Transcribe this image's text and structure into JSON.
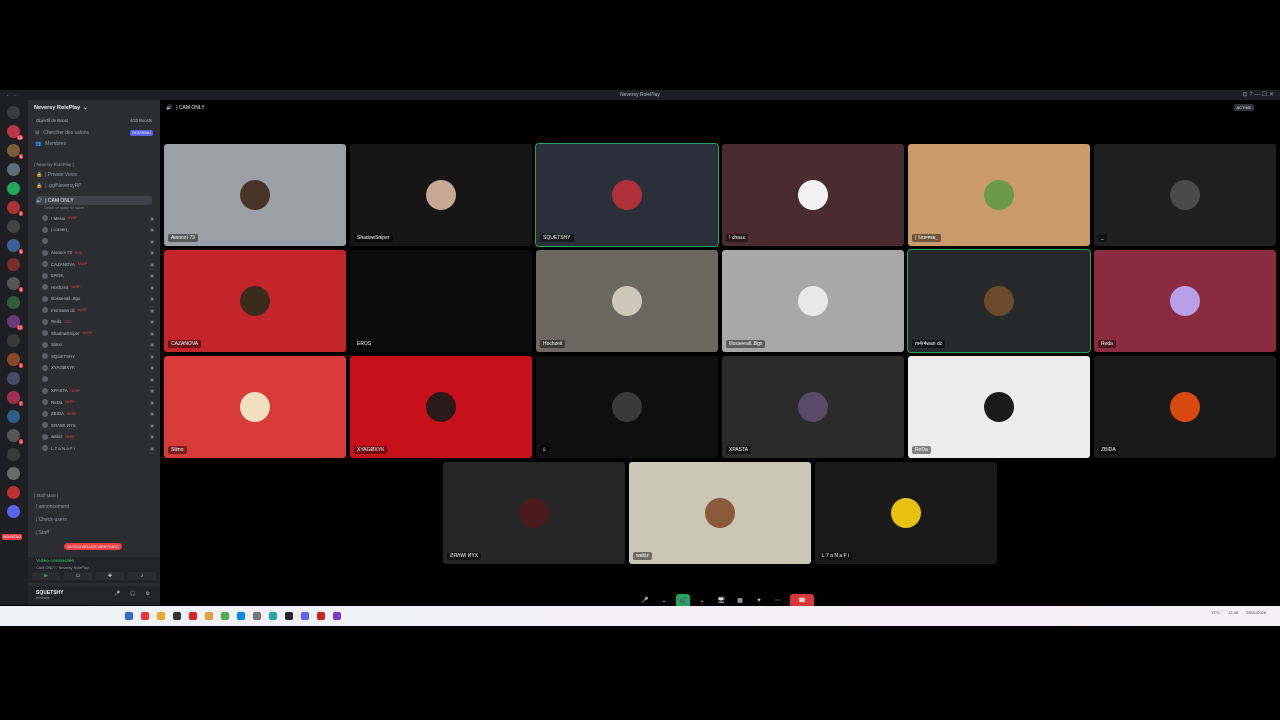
{
  "window": {
    "title": "Neversy RolePlay",
    "nav_arrows": "←  →",
    "controls": "⊡  ?  —  ☐  ✕"
  },
  "servers": {
    "items": [
      {
        "color": "#3b3c42",
        "badge": ""
      },
      {
        "color": "#b8384a",
        "badge": "16"
      },
      {
        "color": "#7a5c3a",
        "badge": "9"
      },
      {
        "color": "#5a6f7a",
        "badge": ""
      },
      {
        "color": "#23a55a",
        "badge": ""
      },
      {
        "color": "#a33",
        "badge": "2"
      },
      {
        "color": "#444",
        "badge": ""
      },
      {
        "color": "#3a5f9a",
        "badge": "5"
      },
      {
        "color": "#7a2b2b",
        "badge": ""
      },
      {
        "color": "#555",
        "badge": "3"
      },
      {
        "color": "#2f5d3a",
        "badge": ""
      },
      {
        "color": "#6a3a7a",
        "badge": "12"
      },
      {
        "color": "#3a3a3a",
        "badge": ""
      },
      {
        "color": "#8a4a2a",
        "badge": "1"
      },
      {
        "color": "#4a4a6a",
        "badge": ""
      },
      {
        "color": "#a03050",
        "badge": "7"
      },
      {
        "color": "#2b5f8a",
        "badge": ""
      },
      {
        "color": "#555",
        "badge": "4"
      },
      {
        "color": "#3a3a3a",
        "badge": ""
      },
      {
        "color": "#6a6a6a",
        "badge": ""
      },
      {
        "color": "#c03030",
        "badge": ""
      },
      {
        "color": "#5865f2",
        "badge": ""
      }
    ]
  },
  "sidebar": {
    "guild_name": "Neversy RolePlay",
    "boost_label": "Objectif de Boost",
    "boost_count": "4/33 Boosts",
    "menu": [
      {
        "label": "Chercher des salons",
        "badge": "NOUVEAU"
      },
      {
        "label": "Membres",
        "badge": ""
      }
    ],
    "category_1": "| Neversy RolePlay |",
    "channels": [
      "| Private Voice",
      "| .gg/NeversyRP",
      "| CAM ONLY"
    ],
    "channel_status": "Définir un statut de salon",
    "voice_members": [
      {
        "name": "! Messi",
        "tag": "NVRP"
      },
      {
        "name": "| coreen_",
        "tag": ""
      },
      {
        "name": "",
        "tag": ""
      },
      {
        "name": "Aiooooï 73",
        "tag": "EOS"
      },
      {
        "name": "CAZANOVA",
        "tag": "NVRP"
      },
      {
        "name": "EROS",
        "tag": ""
      },
      {
        "name": "Hochzeit",
        "tag": "NVRP"
      },
      {
        "name": "Illosseeall..Bgx",
        "tag": ""
      },
      {
        "name": "m4r4wan dz",
        "tag": "NVRP"
      },
      {
        "name": "Reda",
        "tag": "OSC"
      },
      {
        "name": "ShadowSniper",
        "tag": "NVRP"
      },
      {
        "name": "Slimo",
        "tag": ""
      },
      {
        "name": "SQUETSHY",
        "tag": ""
      },
      {
        "name": "XYAGØXYK",
        "tag": ""
      },
      {
        "name": "",
        "tag": ""
      },
      {
        "name": "XPASTA",
        "tag": "OSRP"
      },
      {
        "name": "ReDa",
        "tag": "NVRP"
      },
      {
        "name": "ZBIDA",
        "tag": "NVRP"
      },
      {
        "name": "ƧЯΛWI ИYX",
        "tag": ""
      },
      {
        "name": "wabiz",
        "tag": "NVRP"
      },
      {
        "name": "L 7 a N a F i",
        "tag": ""
      }
    ],
    "category_2": "| Staff Main |",
    "staff_channels": [
      "| annoncement",
      "| Check-users",
      "| Staff"
    ],
    "mentions": "16 NOUVELLES MENTIONS",
    "nouveau": "NOUVEAU",
    "vc_status": "Vidéo connectée",
    "vc_sub": "CAM ONLY / Neversy RolePlay",
    "user_name": "SQUETSHY",
    "user_status": "Invisible",
    "user_icons": "🎤 🎧 ⚙"
  },
  "main": {
    "channel": "| CAM ONLY",
    "active_badge": "ACTIVE",
    "tiles": [
      {
        "label": "Aiooooï 73",
        "bg": "#9aa0a6",
        "avatar": "#4a3428",
        "speaking": false
      },
      {
        "label": "ShadowSniper",
        "bg": "#161616",
        "avatar": "#c8a890",
        "speaking": false
      },
      {
        "label": "SQUETSHY",
        "bg": "#2a2f3a",
        "avatar": "#b0303a",
        "speaking": true
      },
      {
        "label": "! ꜱhaꜱꜱ",
        "bg": "#4a2b32",
        "avatar": "#f2f2f2",
        "speaking": false
      },
      {
        "label": "| 𝕊ᴋɪᴘᴘᴇʀ_",
        "bg": "#c99a6a",
        "avatar": "#6a9a4a",
        "speaking": false
      },
      {
        "label": "_",
        "bg": "#1f1f1f",
        "avatar": "#4a4a4a",
        "speaking": false
      },
      {
        "label": "CAZANOVA",
        "bg": "#c3252b",
        "avatar": "#3a2b1a",
        "speaking": false
      },
      {
        "label": "EROS",
        "bg": "#0c0c0c",
        "avatar": "#0c0c0c",
        "speaking": false
      },
      {
        "label": "Hochzeit",
        "bg": "#6b6860",
        "avatar": "#cfc7b8",
        "speaking": false
      },
      {
        "label": "Illosseeall..Bgx",
        "bg": "#a8a8a8",
        "avatar": "#e8e8e8",
        "speaking": false
      },
      {
        "label": "m4r4wan dz",
        "bg": "#262a2a",
        "avatar": "#6a4a2a",
        "speaking": true
      },
      {
        "label": "Reda",
        "bg": "#8a2b3f",
        "avatar": "#b8a0e8",
        "speaking": false
      },
      {
        "label": "Slimo",
        "bg": "#d83a3a",
        "avatar": "#f0e0c0",
        "speaking": false
      },
      {
        "label": "XYAGØXYK",
        "bg": "#c8101a",
        "avatar": "#2a1a1a",
        "speaking": false
      },
      {
        "label": "ﾑ",
        "bg": "#0f0f0f",
        "avatar": "#3a3a3a",
        "speaking": false
      },
      {
        "label": "XPASTA",
        "bg": "#2b2b2b",
        "avatar": "#5a4a6a",
        "speaking": false
      },
      {
        "label": "ReDa",
        "bg": "#ececec",
        "avatar": "#1a1a1a",
        "speaking": false
      },
      {
        "label": "ZBIDA",
        "bg": "#1a1a1a",
        "avatar": "#d84a10",
        "speaking": false
      },
      {
        "label": "ƧЯΛWI ИYX",
        "bg": "#262626",
        "avatar": "#4a1a1a",
        "speaking": false
      },
      {
        "label": "wabiz",
        "bg": "#cbc7b6",
        "avatar": "#8a5a3a",
        "speaking": false
      },
      {
        "label": "L 7 a N a F i",
        "bg": "#1a1a1a",
        "avatar": "#e8c010",
        "speaking": false
      }
    ],
    "call_controls": [
      "🎤",
      "⌄",
      "📹",
      "⌄",
      "🖥",
      "▦",
      "✦",
      "⋯"
    ],
    "hangup": "☎"
  },
  "taskbar": {
    "tray_text": "17°C",
    "time": "17:36",
    "date": "25/01/2026"
  }
}
